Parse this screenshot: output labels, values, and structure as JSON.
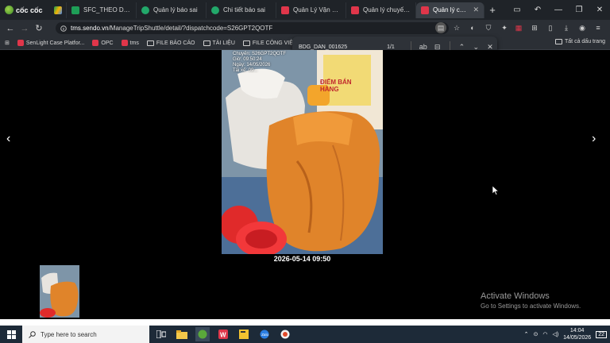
{
  "browser": {
    "brand": "cốc cốc",
    "tabs": [
      {
        "label": "",
        "icon": "google-drive-icon"
      },
      {
        "label": "SFC_THEO DÕI ĐỐI",
        "icon": "sheets-icon"
      },
      {
        "label": "Quản lý báo sai",
        "icon": "green-circle-icon"
      },
      {
        "label": "Chi tiết báo sai",
        "icon": "green-circle-icon"
      },
      {
        "label": "Quản Lý Vận Đơn C",
        "icon": "red-app-icon"
      },
      {
        "label": "Quản lý chuyến xe",
        "icon": "red-app-icon"
      },
      {
        "label": "Quản lý chuyế",
        "icon": "red-app-icon",
        "active": true
      }
    ],
    "url": {
      "host": "tms.sendo.vn",
      "path": "/ManageTripShuttle/detail/?dispatchcode=S26GPT2QOTF"
    },
    "bookmarks": [
      {
        "label": "SenLight Case Platfor...",
        "icon": "red-app-icon"
      },
      {
        "label": "OPC",
        "icon": "red-app-icon"
      },
      {
        "label": "tms",
        "icon": "red-app-icon"
      },
      {
        "label": "FILE BÁO CÁO",
        "icon": "folder-icon"
      },
      {
        "label": "TÀI LIỆU",
        "icon": "folder-icon"
      },
      {
        "label": "FILE CÔNG VIỆC",
        "icon": "folder-icon"
      }
    ],
    "bookmarks_all": "Tất cả dấu trang"
  },
  "find": {
    "query": "BDG_DAN_001625",
    "count": "1/1",
    "match_case": "ab"
  },
  "viewer": {
    "caption": "2026-05-14 09:50",
    "watermark_lines": [
      "Chuyến: S26GPT2QOTF",
      "Giờ: 09:50:24",
      "Ngày: 14/05/2026",
      "Tài xế: 09..."
    ],
    "sign_text": [
      "ĐIỂM BÁN",
      "HÀNG"
    ]
  },
  "windows": {
    "activate_title": "Activate Windows",
    "activate_sub": "Go to Settings to activate Windows."
  },
  "taskbar": {
    "search_placeholder": "Type here to search",
    "time": "14:04",
    "date": "14/05/2026",
    "notif": "22",
    "lang": "ENG"
  },
  "colors": {
    "tabbar": "#1f2328",
    "toolbar": "#2b2f35",
    "accent_red": "#e0364a",
    "taskbar": "#1d2a38"
  }
}
